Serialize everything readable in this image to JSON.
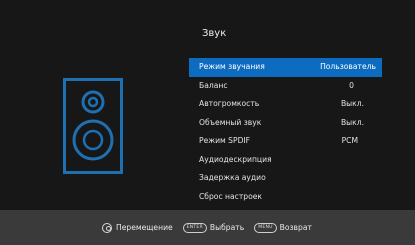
{
  "menu": {
    "title": "Звук",
    "items": [
      {
        "label": "Режим звучания",
        "value": "Пользователь",
        "selected": true
      },
      {
        "label": "Баланс",
        "value": "0"
      },
      {
        "label": "Автогромкость",
        "value": "Выкл."
      },
      {
        "label": "Объемный звук",
        "value": "Выкл."
      },
      {
        "label": "Режим SPDIF",
        "value": "PCM"
      },
      {
        "label": "Аудиодескрипция",
        "value": ""
      },
      {
        "label": "Задержка аудио",
        "value": ""
      },
      {
        "label": "Сброс настроек",
        "value": ""
      }
    ]
  },
  "icon": {
    "name": "speaker-icon"
  },
  "colors": {
    "highlight": "#0e6cc0",
    "background": "#171717",
    "footer": "#3a3a3a"
  },
  "footer": {
    "move_label": "Перемещение",
    "enter_key": "ENTER",
    "select_label": "Выбрать",
    "menu_key": "MENU",
    "back_label": "Возврат"
  }
}
